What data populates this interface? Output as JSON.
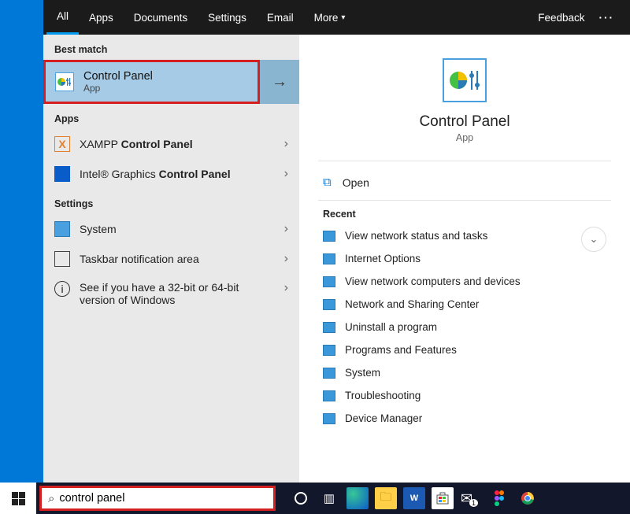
{
  "topbar": {
    "tabs": [
      "All",
      "Apps",
      "Documents",
      "Settings",
      "Email",
      "More"
    ],
    "feedback": "Feedback"
  },
  "left": {
    "best_match_header": "Best match",
    "best_match": {
      "title": "Control Panel",
      "sub": "App"
    },
    "apps_header": "Apps",
    "apps": [
      {
        "prefix": "XAMPP ",
        "bold": "Control Panel"
      },
      {
        "prefix": "Intel® Graphics ",
        "bold": "Control Panel"
      }
    ],
    "settings_header": "Settings",
    "settings": [
      "System",
      "Taskbar notification area",
      "See if you have a 32-bit or 64-bit version of Windows"
    ]
  },
  "detail": {
    "title": "Control Panel",
    "sub": "App",
    "open": "Open",
    "recent_header": "Recent",
    "recent": [
      "View network status and tasks",
      "Internet Options",
      "View network computers and devices",
      "Network and Sharing Center",
      "Uninstall a program",
      "Programs and Features",
      "System",
      "Troubleshooting",
      "Device Manager"
    ]
  },
  "taskbar": {
    "search_value": "control panel"
  }
}
